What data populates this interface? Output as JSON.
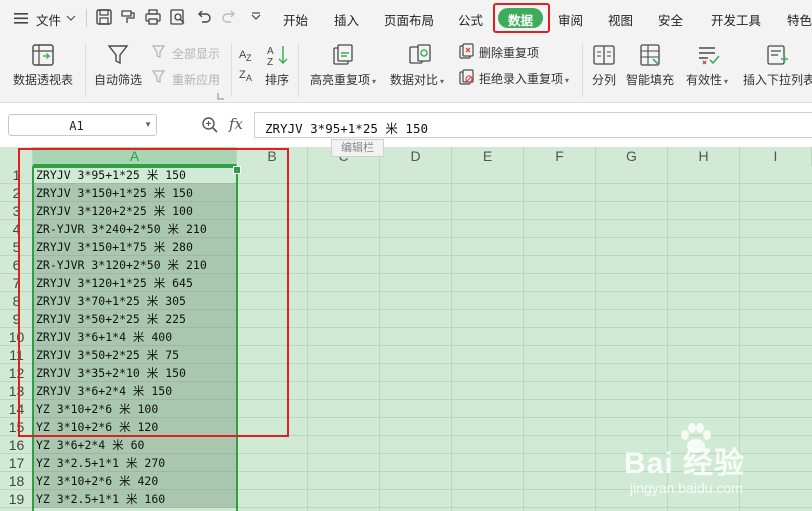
{
  "menu": {
    "file": "文件",
    "tabs": [
      "开始",
      "插入",
      "页面布局",
      "公式",
      "数据",
      "审阅",
      "视图",
      "安全",
      "开发工具",
      "特色"
    ],
    "active_tab": "数据"
  },
  "ribbon": {
    "pivot_table": "数据透视表",
    "auto_filter": "自动筛选",
    "show_all": "全部显示",
    "reapply": "重新应用",
    "sort": "排序",
    "highlight_dup": "高亮重复项",
    "compare": "数据对比",
    "remove_dup": "删除重复项",
    "reject_dup": "拒绝录入重复项",
    "split": "分列",
    "smart_fill": "智能填充",
    "validity": "有效性",
    "insert_dropdown": "插入下拉列表"
  },
  "formula_bar": {
    "cell_ref": "A1",
    "fx": "fx",
    "content": "ZRYJV 3*95+1*25 米 150",
    "tooltip": "编辑栏"
  },
  "grid": {
    "columns": [
      "A",
      "B",
      "C",
      "D",
      "E",
      "F",
      "G",
      "H",
      "I"
    ],
    "rows": [
      {
        "num": "1",
        "a": "ZRYJV 3*95+1*25 米 150"
      },
      {
        "num": "2",
        "a": "ZRYJV 3*150+1*25 米 150"
      },
      {
        "num": "3",
        "a": "ZRYJV 3*120+2*25 米 100"
      },
      {
        "num": "4",
        "a": "ZR-YJVR 3*240+2*50 米 210"
      },
      {
        "num": "5",
        "a": "ZRYJV 3*150+1*75 米 280"
      },
      {
        "num": "6",
        "a": "ZR-YJVR 3*120+2*50 米 210"
      },
      {
        "num": "7",
        "a": "ZRYJV 3*120+1*25 米 645"
      },
      {
        "num": "8",
        "a": "ZRYJV 3*70+1*25 米 305"
      },
      {
        "num": "9",
        "a": "ZRYJV 3*50+2*25 米 225"
      },
      {
        "num": "10",
        "a": "ZRYJV 3*6+1*4 米 400"
      },
      {
        "num": "11",
        "a": "ZRYJV 3*50+2*25 米 75"
      },
      {
        "num": "12",
        "a": "ZRYJV 3*35+2*10 米 150"
      },
      {
        "num": "13",
        "a": "ZRYJV 3*6+2*4 米 150"
      },
      {
        "num": "14",
        "a": "YZ 3*10+2*6 米 100"
      },
      {
        "num": "15",
        "a": "YZ 3*10+2*6 米 120"
      },
      {
        "num": "16",
        "a": "YZ 3*6+2*4 米 60"
      },
      {
        "num": "17",
        "a": "YZ 3*2.5+1*1 米 270"
      },
      {
        "num": "18",
        "a": "YZ 3*10+2*6 米 420"
      },
      {
        "num": "19",
        "a": "YZ 3*2.5+1*1 米 160"
      }
    ]
  },
  "watermark": {
    "brand": "Bai 经验",
    "site": "jingyan.baidu.com"
  },
  "colors": {
    "accent": "#3dad5b",
    "highlight_box": "#e02020",
    "grid_bg": "#d1ead6",
    "selection": "#2f9e44"
  }
}
